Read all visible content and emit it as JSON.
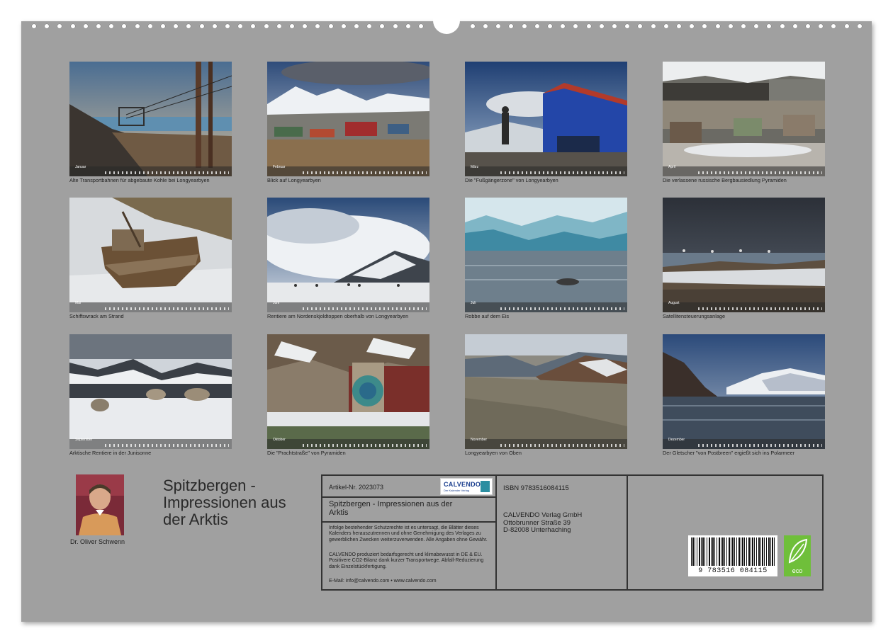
{
  "months": [
    {
      "month": "Januar",
      "caption": "Alte Transportbahnen für abgebaute Kohle bei Longyearbyen"
    },
    {
      "month": "Februar",
      "caption": "Blick auf Longyearbyen"
    },
    {
      "month": "März",
      "caption": "Die \"Fußgängerzone\" von Longyearbyen"
    },
    {
      "month": "April",
      "caption": "Die verlassene russische Bergbausiedlung Pyramiden"
    },
    {
      "month": "Mai",
      "caption": "Schiffswrack am Strand"
    },
    {
      "month": "Juni",
      "caption": "Rentiere am Nordenskjoldtoppen oberhalb von Longyearbyen"
    },
    {
      "month": "Juli",
      "caption": "Robbe auf dem Eis"
    },
    {
      "month": "August",
      "caption": "Satellitensteuerungsanlage"
    },
    {
      "month": "September",
      "caption": "Arktische Rentiere in der Junisonne"
    },
    {
      "month": "Oktober",
      "caption": "Die \"Prachtstraße\" von Pyramiden"
    },
    {
      "month": "November",
      "caption": "Longyearbyen von Oben"
    },
    {
      "month": "Dezember",
      "caption": "Der Gletscher \"von Postbreen\" ergießt sich ins Polarmeer"
    }
  ],
  "author": {
    "name": "Dr. Oliver Schwenn"
  },
  "title_lines": [
    "Spitzbergen -",
    "Impressionen aus",
    "der Arktis"
  ],
  "info": {
    "article_number": "Artikel-Nr. 2023073",
    "brand": "CALVENDO",
    "brand_sub": "Der Kalender Verlag",
    "product_title_line1": "Spitzbergen - Impressionen aus der",
    "product_title_line2": "Arktis",
    "legal_1": "Infolge bestehender Schutzrechte ist es untersagt, die Blätter dieses Kalenders herauszutrennen und ohne Genehmigung des Verlages zu gewerblichen Zwecken weiterzuverwenden. Alle Angaben ohne Gewähr.",
    "legal_2": "CALVENDO produziert bedarfsgerecht und klimabewusst in DE & EU. Positivere CO2-Bilanz dank kurzer Transportwege. Abfall-Reduzierung dank Einzelstückfertigung.",
    "contact": "E-Mail: info@calvendo.com • www.calvendo.com",
    "isbn": "ISBN 9783516084115",
    "publisher_name": "CALVENDO Verlag GmbH",
    "publisher_street": "Ottobrunner Straße 39",
    "publisher_city": "D-82008 Unterhaching",
    "barcode_number": "9 783516 084115",
    "eco_label": "eco"
  }
}
